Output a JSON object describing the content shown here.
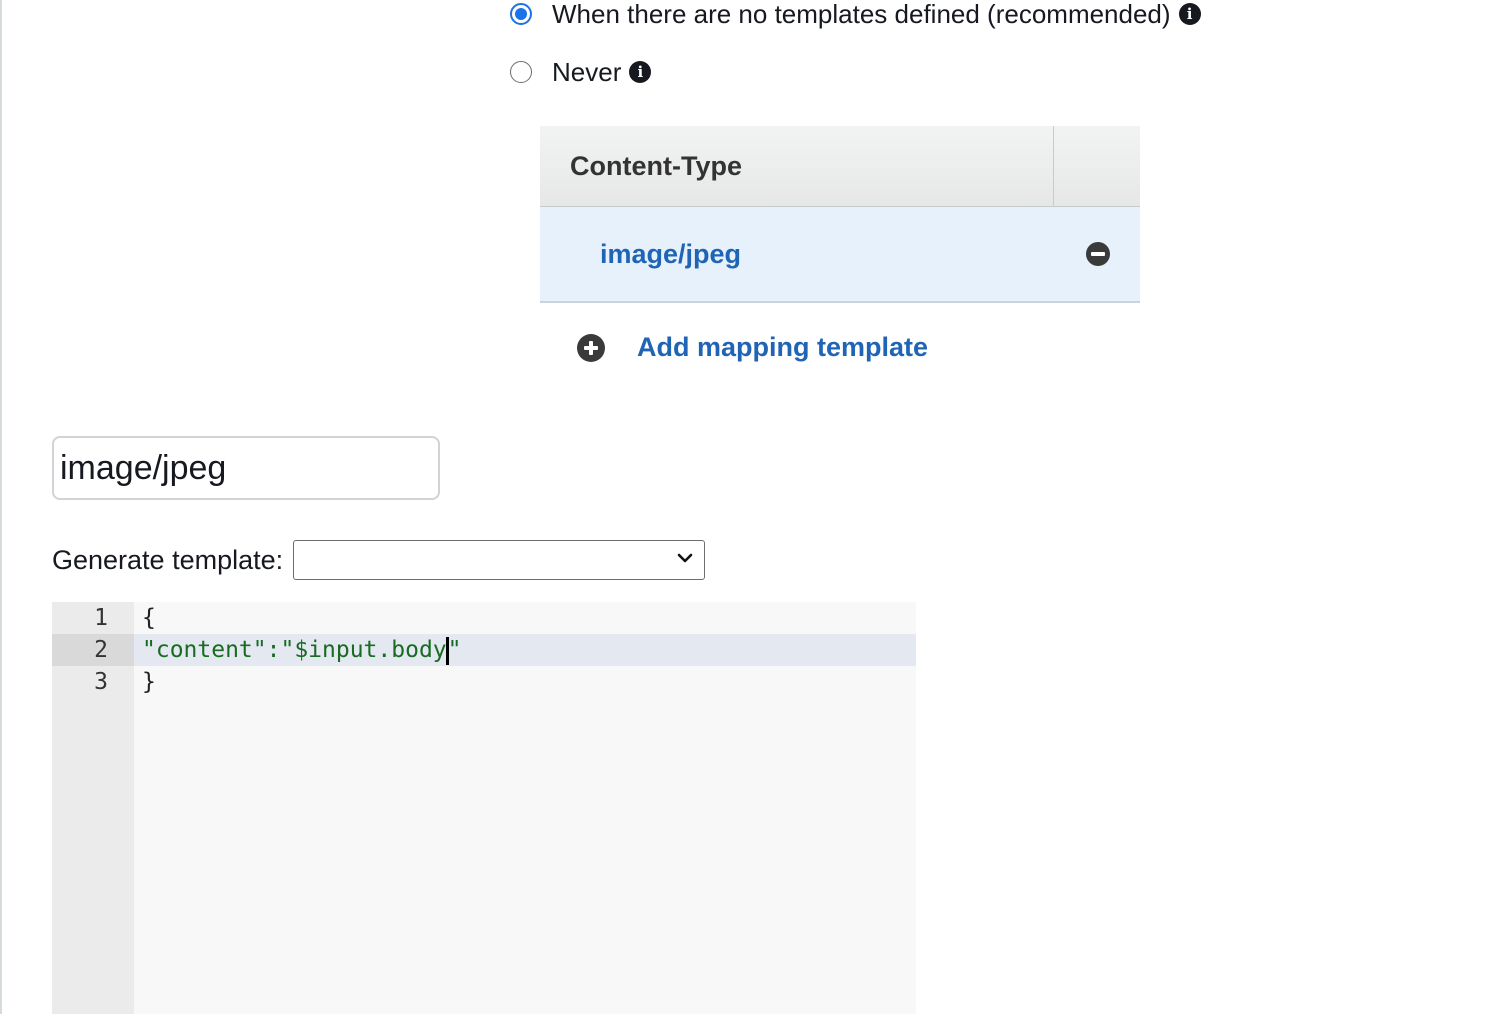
{
  "passthrough": {
    "options": [
      {
        "label": "When there are no templates defined (recommended)",
        "checked": true
      },
      {
        "label": "Never",
        "checked": false
      }
    ]
  },
  "mapping_table": {
    "header": "Content-Type",
    "rows": [
      {
        "content_type": "image/jpeg"
      }
    ],
    "add_label": "Add mapping template"
  },
  "content_type_input": {
    "value": "image/jpeg"
  },
  "generate_template": {
    "label": "Generate template:",
    "selected": ""
  },
  "editor": {
    "lines": [
      {
        "number": "1",
        "text": "{"
      },
      {
        "number": "2",
        "text_before_cursor": "\"content\":\"$input.body",
        "text_after_cursor": "\""
      },
      {
        "number": "3",
        "text": "}"
      }
    ],
    "active_line": 2
  },
  "icons": {
    "info": "info-icon",
    "remove": "remove-circle-icon",
    "add": "add-circle-icon",
    "dropdown": "chevron-down-icon"
  },
  "colors": {
    "accent": "#1a73e8",
    "link": "#1f64b5",
    "selected_row": "#e7f1fb",
    "string": "#1a6b22"
  }
}
